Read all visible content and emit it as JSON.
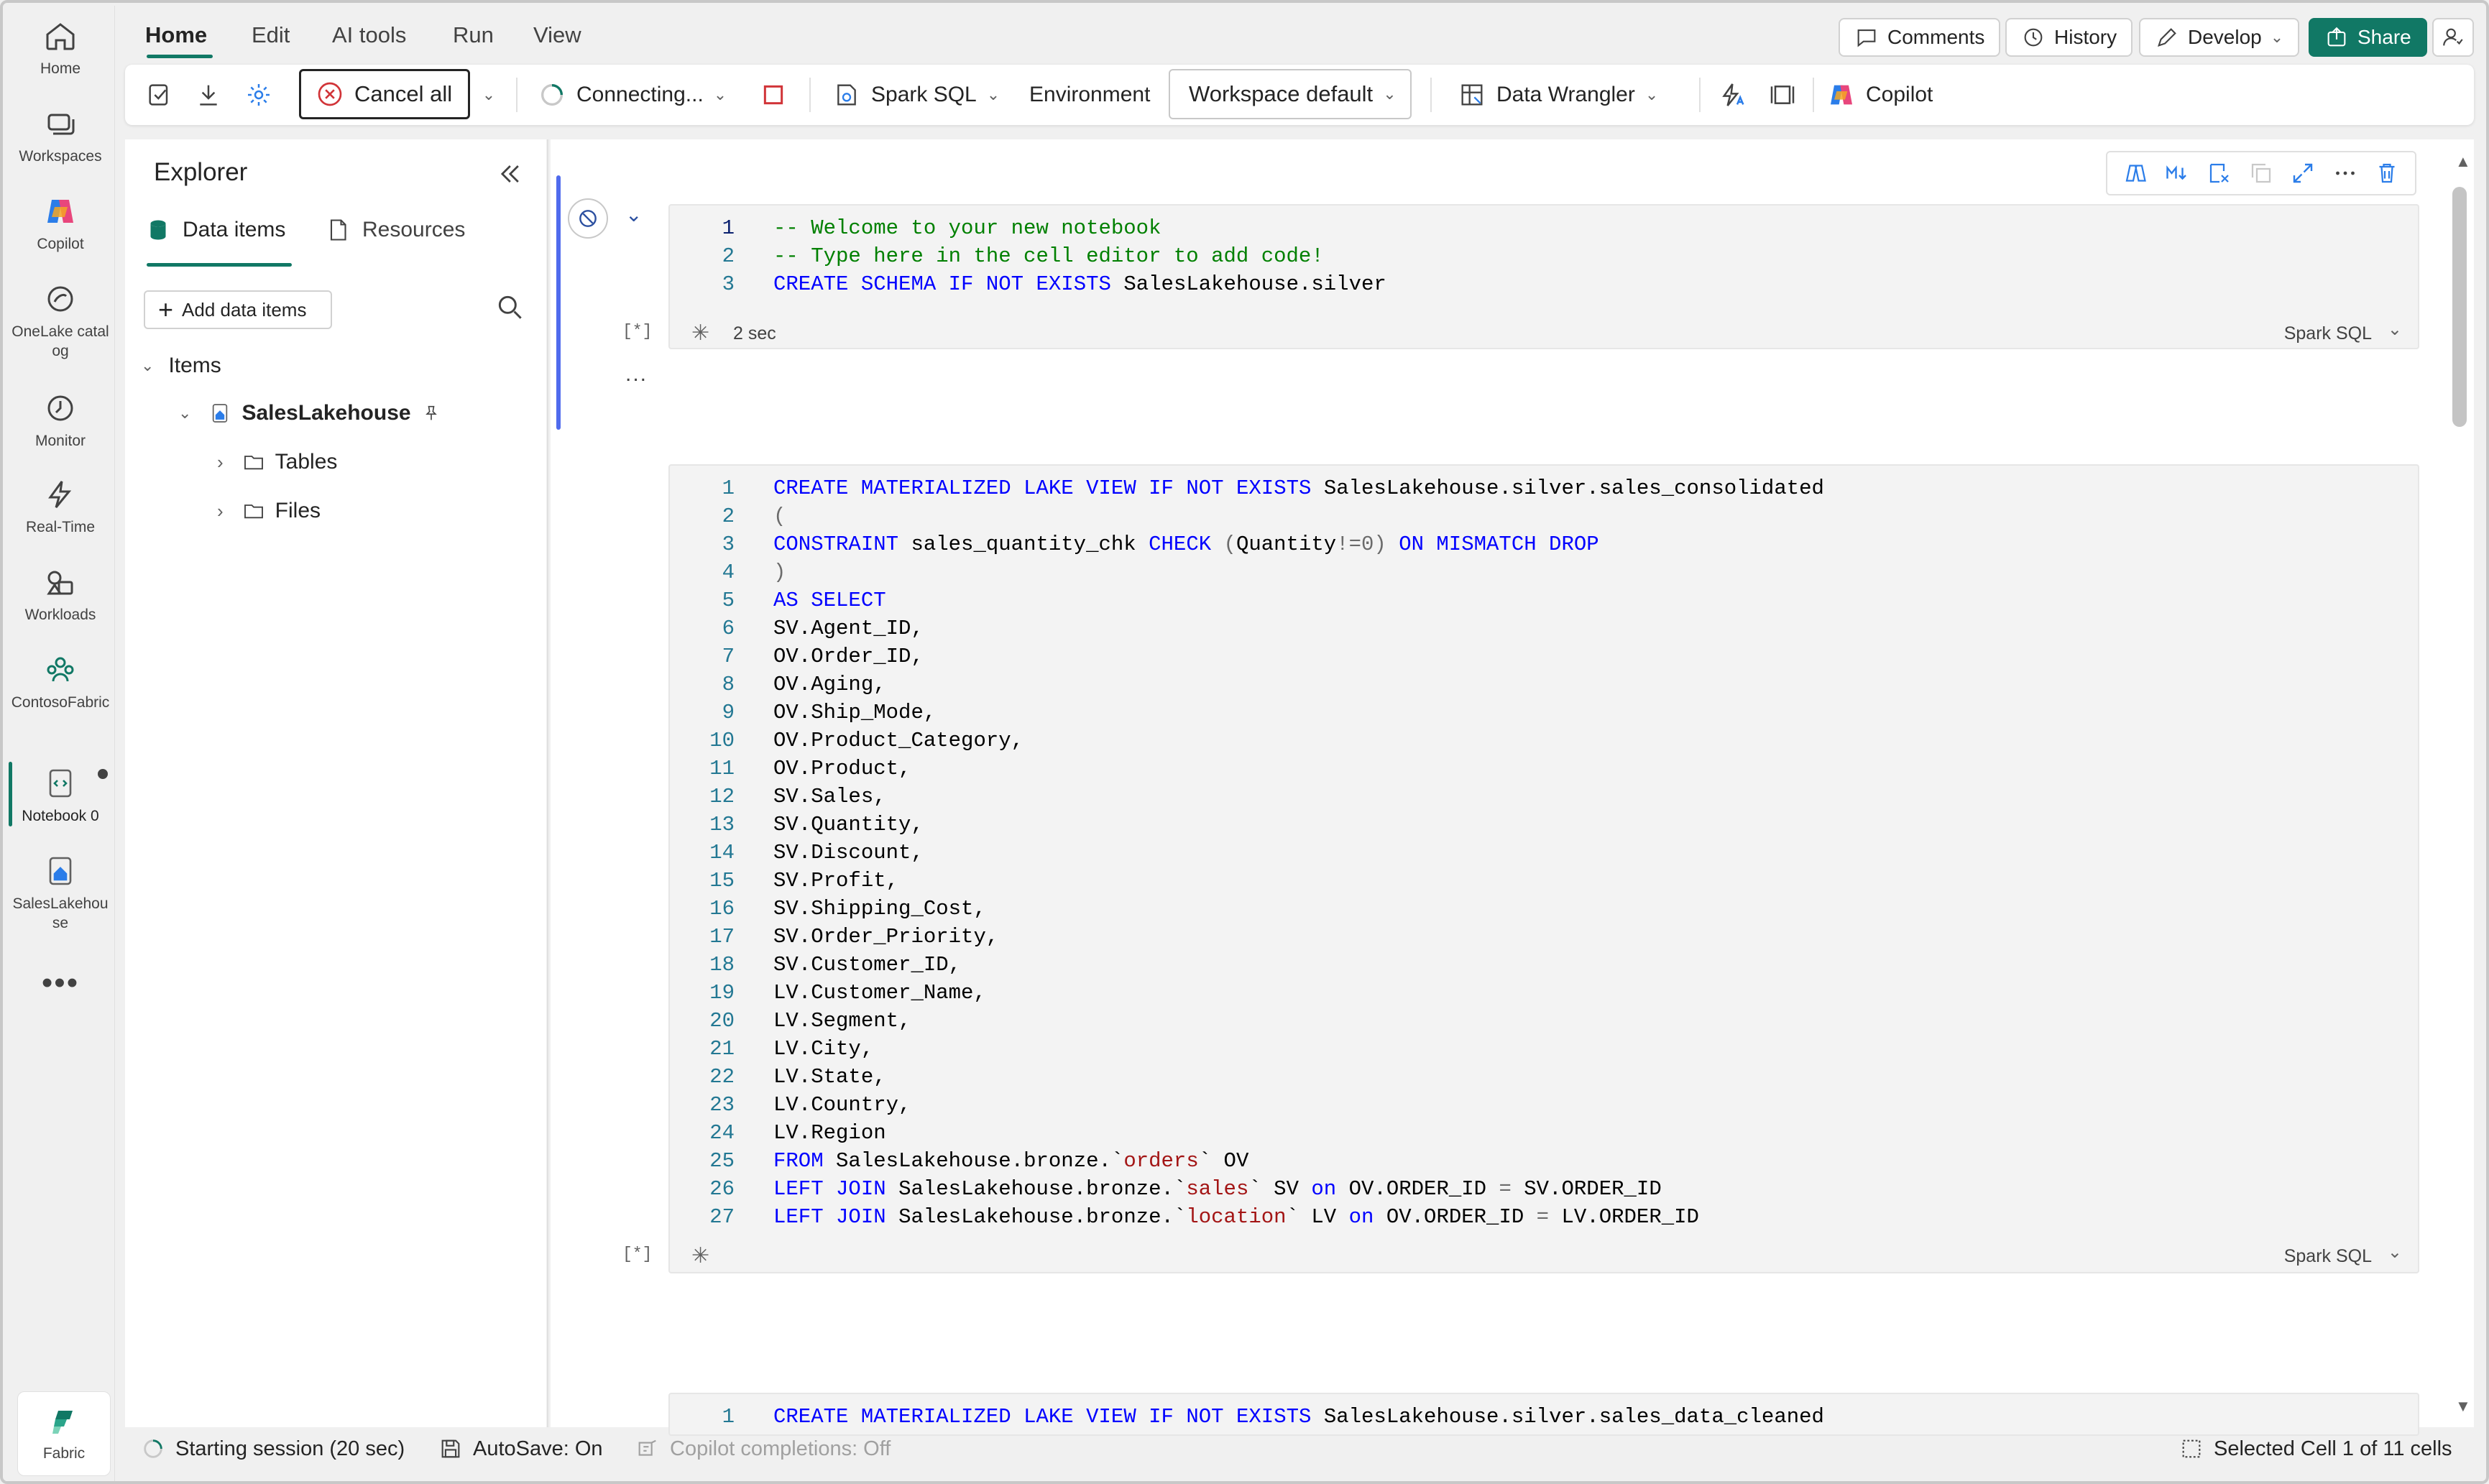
{
  "rail": {
    "items": [
      {
        "label": "Home",
        "icon": "home-icon"
      },
      {
        "label": "Workspaces",
        "icon": "workspaces-icon"
      },
      {
        "label": "Copilot",
        "icon": "copilot-icon"
      },
      {
        "label": "OneLake catalog",
        "icon": "onelake-icon"
      },
      {
        "label": "Monitor",
        "icon": "monitor-icon"
      },
      {
        "label": "Real-Time",
        "icon": "lightning-icon"
      },
      {
        "label": "Workloads",
        "icon": "workloads-icon"
      },
      {
        "label": "ContosoFabric",
        "icon": "workspace-group-icon"
      },
      {
        "label": "Notebook 0",
        "icon": "notebook-icon"
      },
      {
        "label": "SalesLakehouse",
        "icon": "lakehouse-icon"
      }
    ],
    "more": "•••",
    "fabric_label": "Fabric"
  },
  "tabs": [
    "Home",
    "Edit",
    "AI tools",
    "Run",
    "View"
  ],
  "header_buttons": {
    "comments": "Comments",
    "history": "History",
    "develop": "Develop",
    "share": "Share"
  },
  "ribbon": {
    "cancel_all": "Cancel all",
    "connecting": "Connecting...",
    "language": "Spark SQL",
    "environment": "Environment",
    "workspace_default": "Workspace default",
    "data_wrangler": "Data Wrangler",
    "copilot": "Copilot"
  },
  "explorer": {
    "title": "Explorer",
    "tab_data_items": "Data items",
    "tab_resources": "Resources",
    "add_data_items": "Add data items",
    "items_header": "Items",
    "lakehouse": "SalesLakehouse",
    "folders": [
      "Tables",
      "Files"
    ]
  },
  "cells": [
    {
      "lines": [
        "-- Welcome to your new notebook",
        "-- Type here in the cell editor to add code!",
        "CREATE SCHEMA IF NOT EXISTS SalesLakehouse.silver"
      ],
      "exec": "[*]",
      "duration": "2 sec",
      "lang": "Spark SQL"
    },
    {
      "lines": [
        "CREATE MATERIALIZED LAKE VIEW IF NOT EXISTS SalesLakehouse.silver.sales_consolidated",
        "(",
        "CONSTRAINT sales_quantity_chk CHECK (Quantity!=0) ON MISMATCH DROP",
        ")",
        "AS SELECT",
        "SV.Agent_ID,",
        "OV.Order_ID,",
        "OV.Aging,",
        "OV.Ship_Mode,",
        "OV.Product_Category,",
        "OV.Product,",
        "SV.Sales,",
        "SV.Quantity,",
        "SV.Discount,",
        "SV.Profit,",
        "SV.Shipping_Cost,",
        "SV.Order_Priority,",
        "SV.Customer_ID,",
        "LV.Customer_Name,",
        "LV.Segment,",
        "LV.City,",
        "LV.State,",
        "LV.Country,",
        "LV.Region",
        "FROM SalesLakehouse.bronze.`orders` OV",
        "LEFT JOIN SalesLakehouse.bronze.`sales` SV on OV.ORDER_ID = SV.ORDER_ID",
        "LEFT JOIN SalesLakehouse.bronze.`location` LV on OV.ORDER_ID = LV.ORDER_ID"
      ],
      "exec": "[*]",
      "lang": "Spark SQL"
    },
    {
      "lines": [
        "CREATE MATERIALIZED LAKE VIEW IF NOT EXISTS SalesLakehouse.silver.sales_data_cleaned"
      ]
    }
  ],
  "cell_ellipsis": "...",
  "status": {
    "session": "Starting session (20 sec)",
    "autosave": "AutoSave: On",
    "copilot_completions": "Copilot completions: Off",
    "selection": "Selected Cell 1 of 11 cells"
  },
  "colors": {
    "accent": "#117865",
    "keyword": "#0000ff",
    "comment": "#008000",
    "string": "#a31515",
    "cancel_red": "#d13438"
  }
}
